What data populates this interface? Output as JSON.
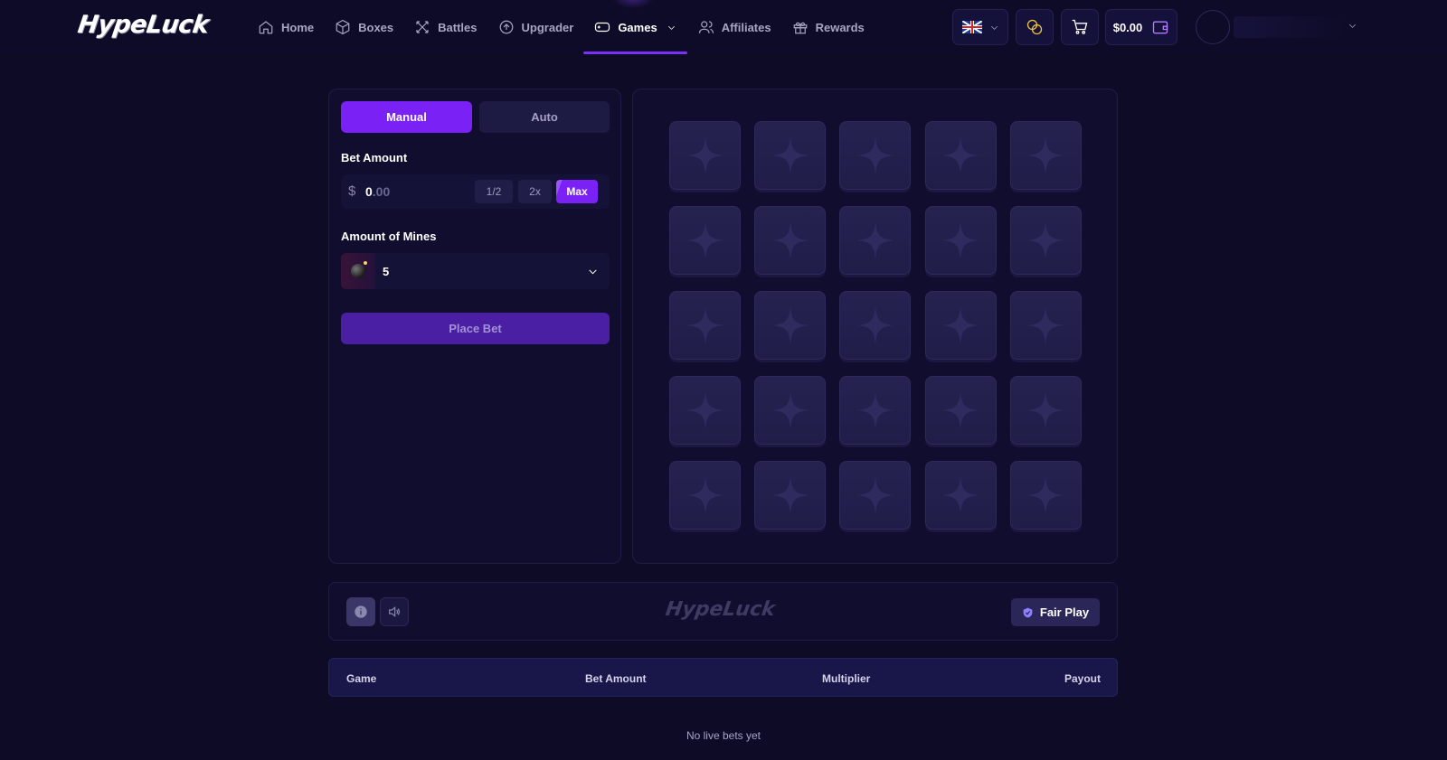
{
  "brand": {
    "logo_text": "HypeLuck"
  },
  "nav": {
    "items": [
      {
        "label": "Home",
        "icon": "home-icon"
      },
      {
        "label": "Boxes",
        "icon": "box-icon"
      },
      {
        "label": "Battles",
        "icon": "swords-icon"
      },
      {
        "label": "Upgrader",
        "icon": "arrow-up-circle-icon"
      },
      {
        "label": "Games",
        "icon": "gamepad-icon",
        "active": true
      },
      {
        "label": "Affiliates",
        "icon": "users-icon"
      },
      {
        "label": "Rewards",
        "icon": "gift-icon"
      }
    ]
  },
  "header": {
    "language": "en-GB",
    "balance": "$0.00"
  },
  "game": {
    "tabs": {
      "manual": "Manual",
      "auto": "Auto",
      "active": "Manual"
    },
    "bet_amount_label": "Bet Amount",
    "currency_symbol": "$",
    "bet_value_int": "0",
    "bet_value_dec": ".00",
    "half_label": "1/2",
    "double_label": "2x",
    "max_label": "Max",
    "mines_label": "Amount of Mines",
    "mines_value": "5",
    "place_bet_label": "Place Bet",
    "grid": {
      "rows": 5,
      "cols": 5
    }
  },
  "footer_bar": {
    "watermark": "HypeLuck",
    "fair_play_label": "Fair Play"
  },
  "bets_table": {
    "columns": [
      "Game",
      "Bet Amount",
      "Multiplier",
      "Payout"
    ],
    "rows": [],
    "empty_text": "No live bets yet"
  },
  "colors": {
    "background": "#0d0b26",
    "accent": "#7a22f5",
    "panel": "#100d2e",
    "tile": "#262250"
  }
}
